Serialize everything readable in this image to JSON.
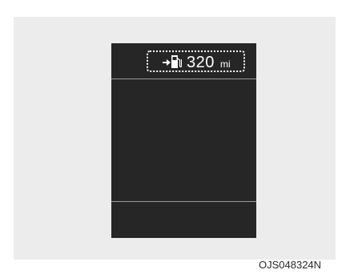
{
  "display": {
    "range_value": "320",
    "range_unit": "mi",
    "icons": [
      "arrow-right-icon",
      "fuel-pump-icon"
    ]
  },
  "footer": {
    "image_code": "OJS048324N"
  },
  "colors": {
    "panel_background": "#ececec",
    "screen_background": "#262626",
    "text": "#ffffff",
    "divider": "#9a9a9a"
  }
}
